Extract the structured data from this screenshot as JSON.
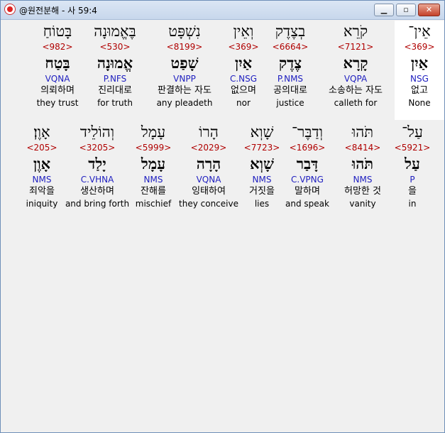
{
  "window": {
    "title": "@원전분해 - 사 59:4",
    "minimize_glyph": "▁",
    "maximize_glyph": "▫",
    "close_glyph": "✕",
    "app_icon": "bible-app-icon"
  },
  "rows": [
    {
      "words": [
        {
          "heb": "אֵין־",
          "strong": "<369>",
          "root": "אַיִן",
          "morph": "NSG",
          "ko": "없고",
          "en": "None",
          "highlight": true
        },
        {
          "heb": "קֹרֵא",
          "strong": "<7121>",
          "root": "קָרָא",
          "morph": "VQPA",
          "ko": "소송하는 자도",
          "en": "calleth for"
        },
        {
          "heb": "בְצֶדֶק",
          "strong": "<6664>",
          "root": "צֶדֶק",
          "morph": "P.NMS",
          "ko": "공의대로",
          "en": "justice"
        },
        {
          "heb": "וְאֵין",
          "strong": "<369>",
          "root": "אַיִן",
          "morph": "C.NSG",
          "ko": "없으며",
          "en": "nor"
        },
        {
          "heb": "נִשְׁפָּט",
          "strong": "<8199>",
          "root": "שָׁפַט",
          "morph": "VNPP",
          "ko": "판결하는 자도",
          "en": "any pleadeth"
        },
        {
          "heb": "בֶּאֱמוּנָה",
          "strong": "<530>",
          "root": "אֱמוּנָה",
          "morph": "P.NFS",
          "ko": "진리대로",
          "en": "for truth"
        },
        {
          "heb": "בָּטוֹחַ",
          "strong": "<982>",
          "root": "בָּטַח",
          "morph": "VQNA",
          "ko": "의뢰하며",
          "en": "they trust"
        }
      ]
    },
    {
      "words": [
        {
          "heb": "עַל־",
          "strong": "<5921>",
          "root": "עַל",
          "morph": "P",
          "ko": "을",
          "en": "in"
        },
        {
          "heb": "תֹּהוּ",
          "strong": "<8414>",
          "root": "תֹּהוּ",
          "morph": "NMS",
          "ko": "허망한 것",
          "en": "vanity"
        },
        {
          "heb": "וְדַבֶּר־",
          "strong": "<1696>",
          "root": "דָּבַר",
          "morph": "C.VPNG",
          "ko": "말하며",
          "en": "and speak"
        },
        {
          "heb": "שָׁוְא",
          "strong": "<7723>",
          "root": "שָׁוְא",
          "morph": "NMS",
          "ko": "거짓을",
          "en": "lies"
        },
        {
          "heb": "הָרוֹ",
          "strong": "<2029>",
          "root": "הָרָה",
          "morph": "VQNA",
          "ko": "잉태하여",
          "en": "they conceive"
        },
        {
          "heb": "עָמָל",
          "strong": "<5999>",
          "root": "עָמָל",
          "morph": "NMS",
          "ko": "잔해를",
          "en": "mischief"
        },
        {
          "heb": "וְהוֹלֵיד",
          "strong": "<3205>",
          "root": "יָלַד",
          "morph": "C.VHNA",
          "ko": "생산하며",
          "en": "and bring forth"
        },
        {
          "heb": "אָוֶן׃",
          "strong": "<205>",
          "root": "אָוֶן",
          "morph": "NMS",
          "ko": "죄악을",
          "en": "iniquity"
        }
      ]
    }
  ]
}
